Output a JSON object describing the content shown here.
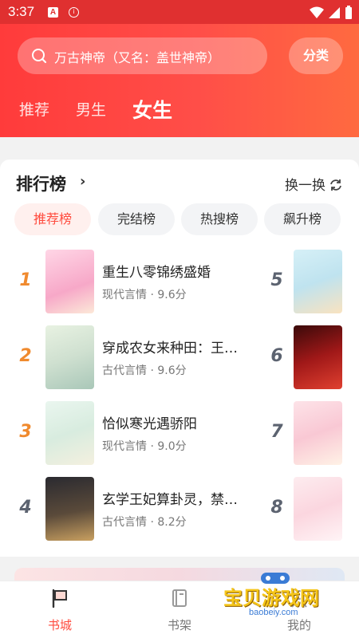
{
  "status_bar": {
    "time": "3:37",
    "a_badge": "A",
    "info_glyph": "i"
  },
  "search": {
    "placeholder": "万古神帝（又名：盖世神帝）"
  },
  "category_button": "分类",
  "top_tabs": [
    "推荐",
    "男生",
    "女生"
  ],
  "active_top_tab": "女生",
  "ranking": {
    "title": "排行榜",
    "chevron": "›",
    "refresh_label": "换一换",
    "chips": [
      "推荐榜",
      "完结榜",
      "热搜榜",
      "飙升榜"
    ],
    "active_chip": "推荐榜",
    "left_books": [
      {
        "rank": "1",
        "title": "重生八零锦绣盛婚",
        "genre": "现代言情",
        "score": "9.6分",
        "rank_color": "#f08a2e"
      },
      {
        "rank": "2",
        "title": "穿成农女来种田：王…",
        "genre": "古代言情",
        "score": "9.6分",
        "rank_color": "#f08a2e"
      },
      {
        "rank": "3",
        "title": "恰似寒光遇骄阳",
        "genre": "现代言情",
        "score": "9.0分",
        "rank_color": "#f08a2e"
      },
      {
        "rank": "4",
        "title": "玄学王妃算卦灵，禁…",
        "genre": "古代言情",
        "score": "8.2分",
        "rank_color": "#5c6370"
      }
    ],
    "right_books": [
      {
        "rank": "5"
      },
      {
        "rank": "6"
      },
      {
        "rank": "7"
      },
      {
        "rank": "8"
      }
    ]
  },
  "bottom_nav": [
    {
      "label": "书城",
      "active": true,
      "icon": "flag-icon"
    },
    {
      "label": "书架",
      "active": false,
      "icon": "book-icon"
    },
    {
      "label": "我的",
      "active": false,
      "icon": "profile-icon"
    }
  ],
  "watermark": {
    "text": "宝贝游戏网",
    "url": "baobeiy.com"
  },
  "colors": {
    "accent": "#ff4b3e",
    "header": "#ff3b3b"
  }
}
